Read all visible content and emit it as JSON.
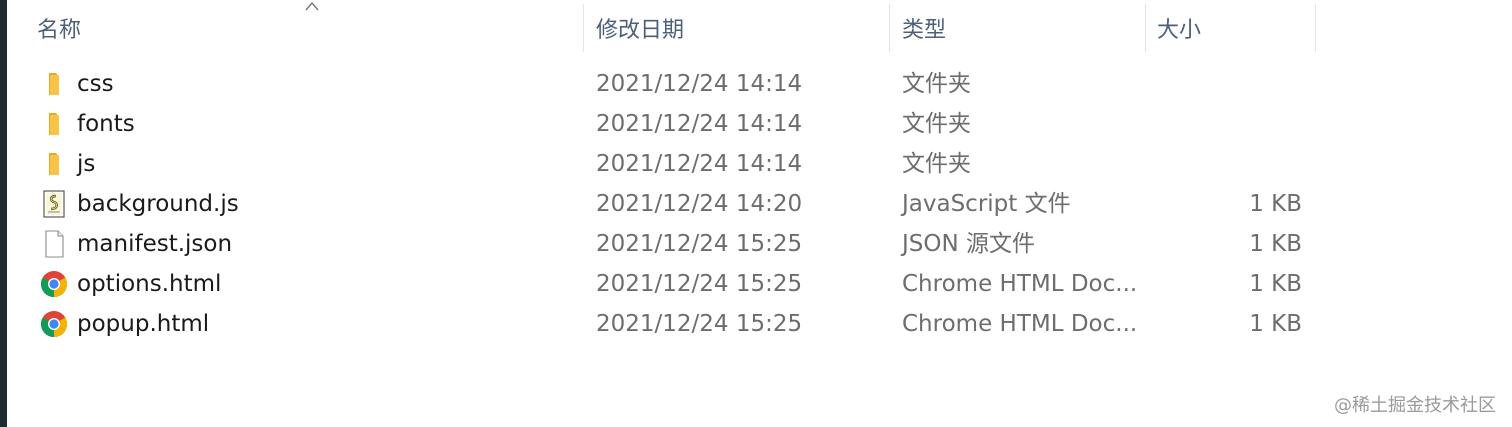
{
  "header": {
    "columns": [
      {
        "label": "名称"
      },
      {
        "label": "修改日期"
      },
      {
        "label": "类型"
      },
      {
        "label": "大小"
      }
    ]
  },
  "files": [
    {
      "name": "css",
      "date": "2021/12/24 14:14",
      "type": "文件夹",
      "size": "",
      "icon": "folder-icon"
    },
    {
      "name": "fonts",
      "date": "2021/12/24 14:14",
      "type": "文件夹",
      "size": "",
      "icon": "folder-icon"
    },
    {
      "name": "js",
      "date": "2021/12/24 14:14",
      "type": "文件夹",
      "size": "",
      "icon": "folder-icon"
    },
    {
      "name": "background.js",
      "date": "2021/12/24 14:20",
      "type": "JavaScript 文件",
      "size": "1 KB",
      "icon": "script-file-icon"
    },
    {
      "name": "manifest.json",
      "date": "2021/12/24 15:25",
      "type": "JSON 源文件",
      "size": "1 KB",
      "icon": "blank-file-icon"
    },
    {
      "name": "options.html",
      "date": "2021/12/24 15:25",
      "type": "Chrome HTML Doc...",
      "size": "1 KB",
      "icon": "chrome-icon"
    },
    {
      "name": "popup.html",
      "date": "2021/12/24 15:25",
      "type": "Chrome HTML Doc...",
      "size": "1 KB",
      "icon": "chrome-icon"
    }
  ],
  "watermark": "@稀土掘金技术社区",
  "colors": {
    "header_text": "#4c607a",
    "secondary_text": "#6d6d6d",
    "primary_text": "#1a1a1a",
    "folder": "#f8c445"
  }
}
